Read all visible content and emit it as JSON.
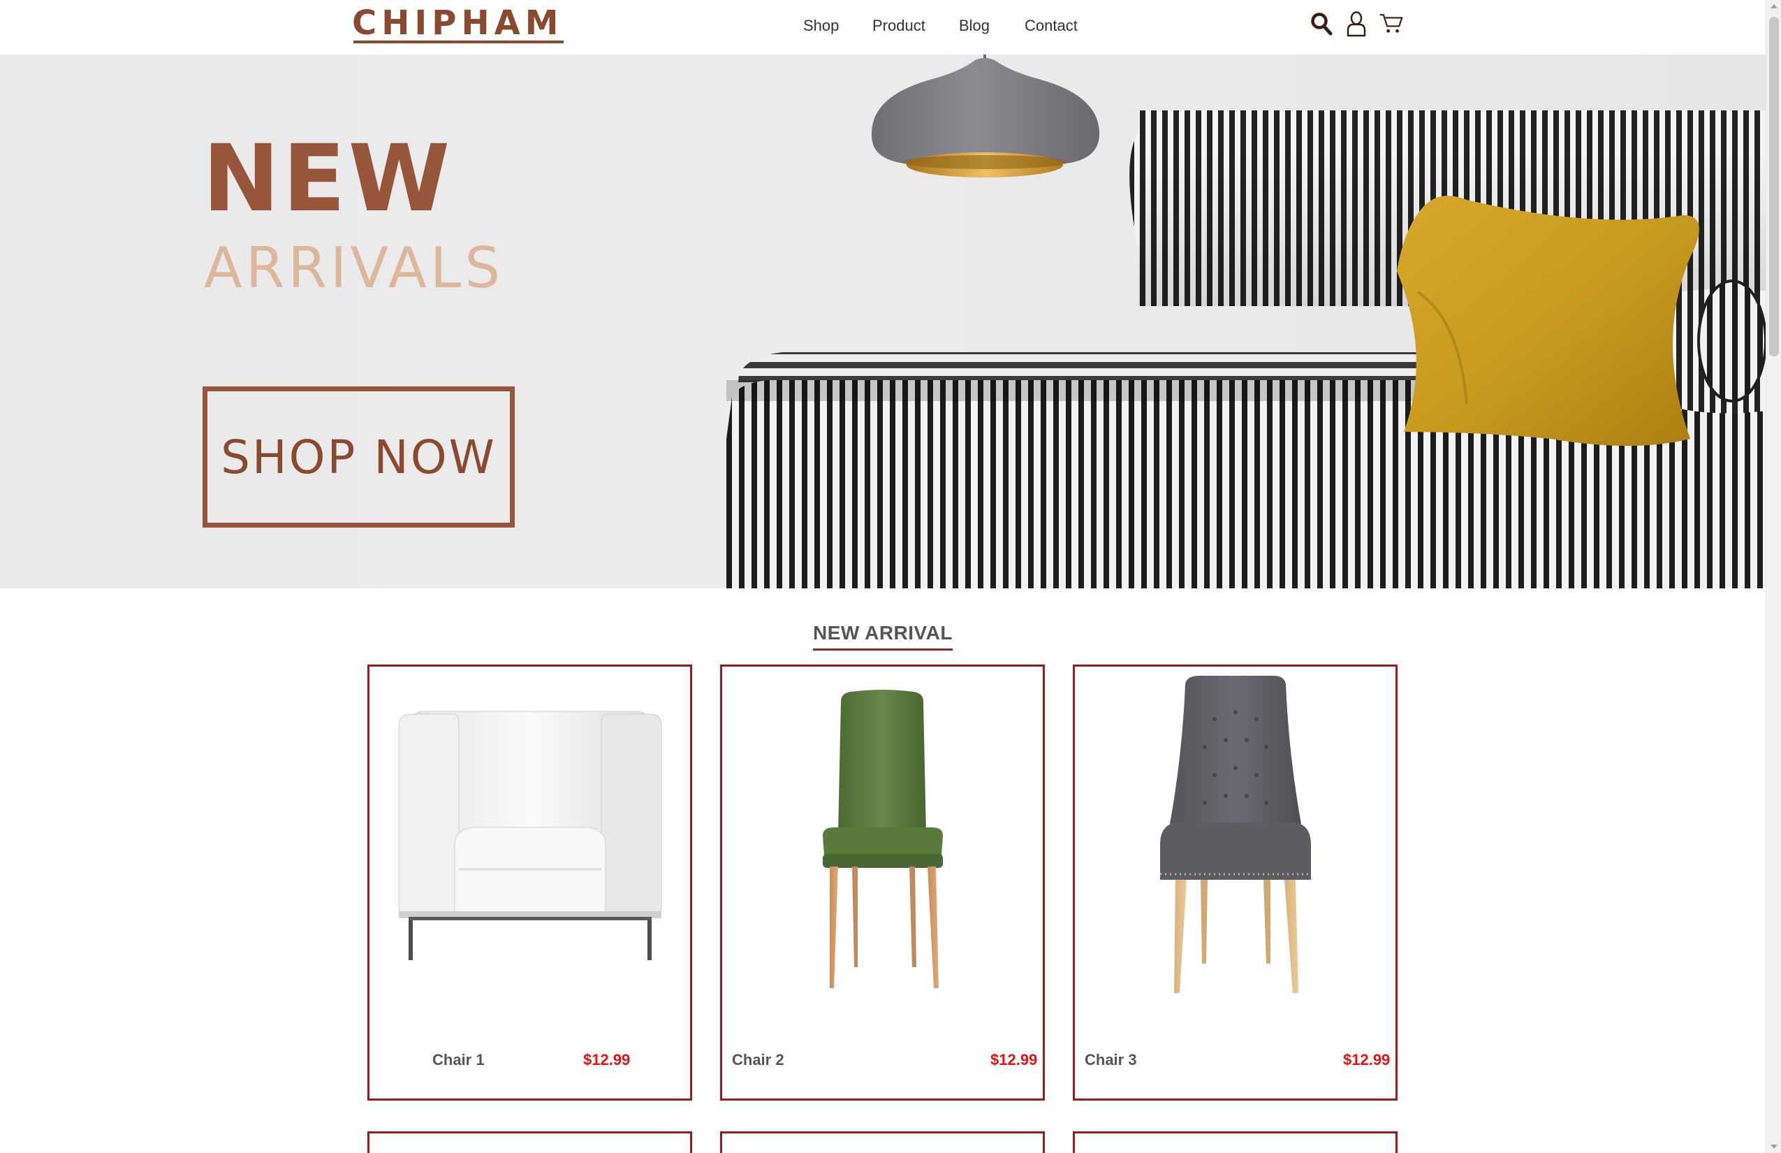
{
  "header": {
    "logo": "CHIPHAM",
    "nav": [
      {
        "label": "Shop"
      },
      {
        "label": "Product"
      },
      {
        "label": "Blog"
      },
      {
        "label": "Contact"
      }
    ],
    "icons": [
      "search-icon",
      "user-icon",
      "cart-icon"
    ]
  },
  "hero": {
    "headline": "NEW",
    "subheadline": "ARRIVALS",
    "cta_label": "SHOP NOW"
  },
  "section": {
    "title": "NEW ARRIVAL"
  },
  "products": [
    {
      "name": "Chair 1",
      "price": "$12.99"
    },
    {
      "name": "Chair 2",
      "price": "$12.99"
    },
    {
      "name": "Chair 3",
      "price": "$12.99"
    }
  ],
  "colors": {
    "brand": "#8b4a2f",
    "accent_light": "#dcb79c",
    "card_border": "#9a1d1d",
    "price": "#e61414"
  }
}
